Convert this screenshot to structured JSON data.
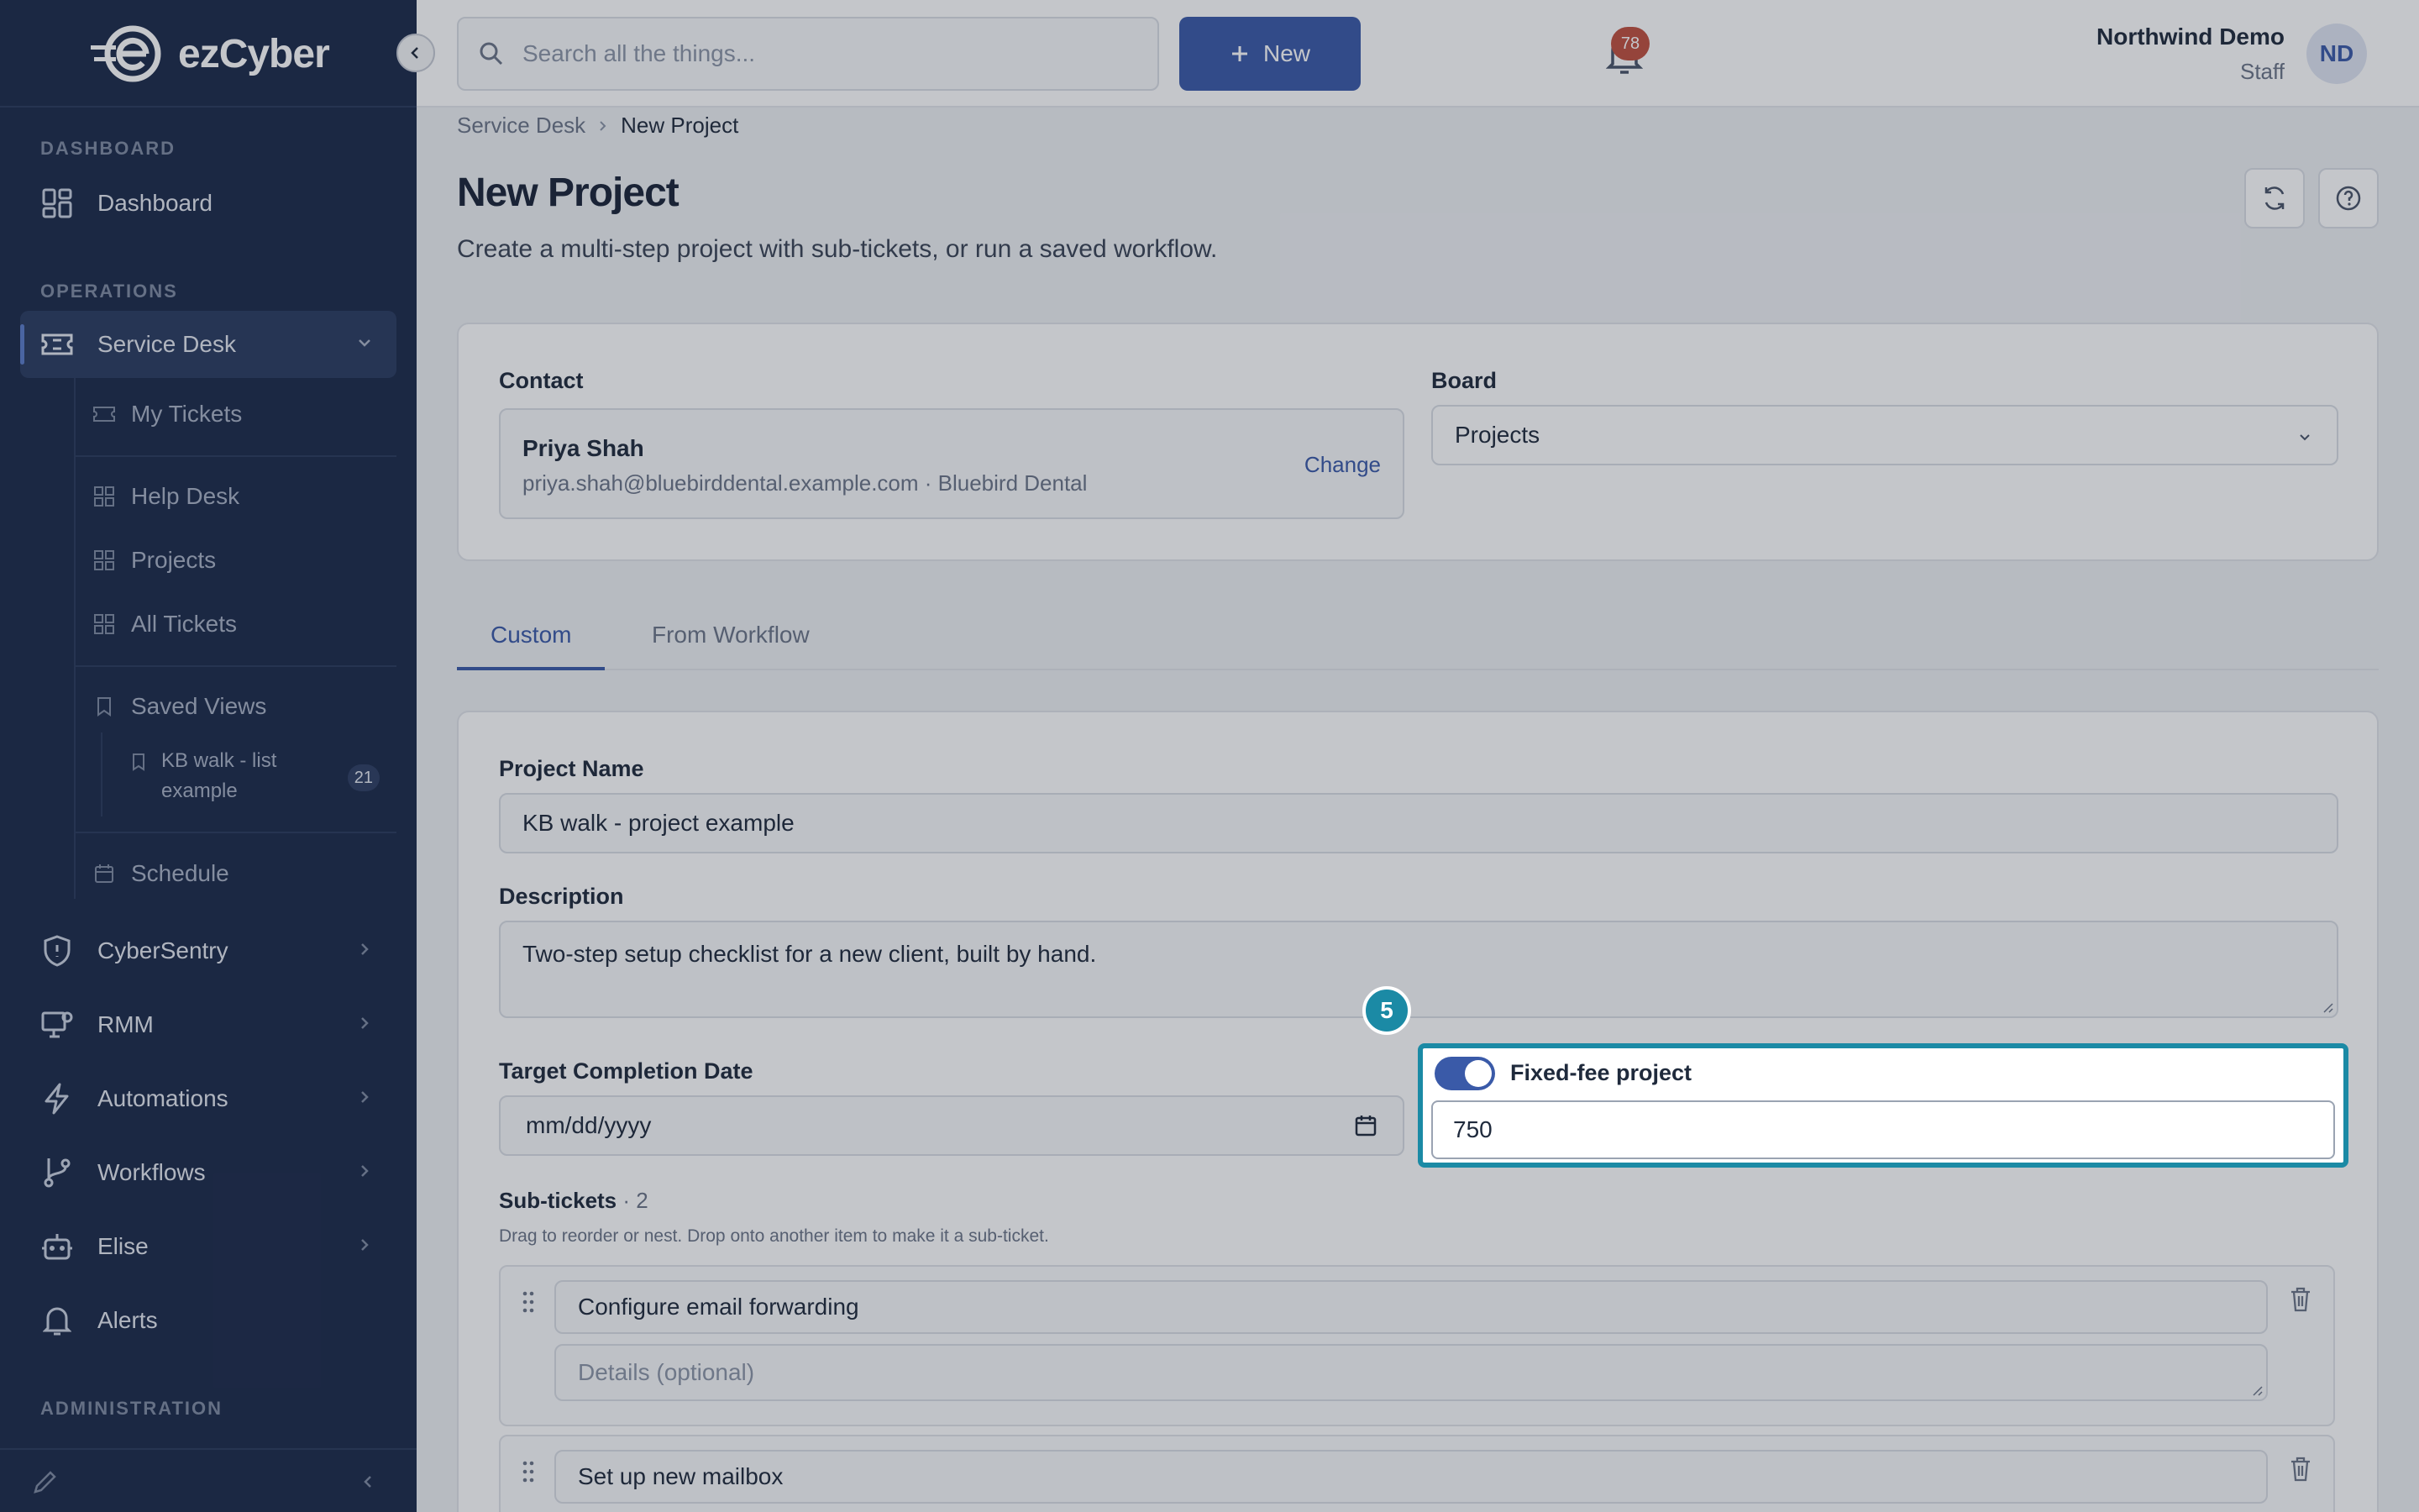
{
  "app": {
    "brand": "ezCyber"
  },
  "sidebar": {
    "sections": {
      "dashboard": "DASHBOARD",
      "operations": "OPERATIONS",
      "administration": "ADMINISTRATION"
    },
    "dashboard": "Dashboard",
    "service_desk": "Service Desk",
    "sub_items": {
      "my_tickets": "My Tickets",
      "help_desk": "Help Desk",
      "projects": "Projects",
      "all_tickets": "All Tickets",
      "saved_views": "Saved Views",
      "saved_view_item": "KB walk - list example",
      "saved_view_count": "21",
      "schedule": "Schedule"
    },
    "items": {
      "cybersentry": "CyberSentry",
      "rmm": "RMM",
      "automations": "Automations",
      "workflows": "Workflows",
      "elise": "Elise",
      "alerts": "Alerts"
    }
  },
  "header": {
    "search_placeholder": "Search all the things...",
    "new_label": "New",
    "notifications_count": "78",
    "user_name": "Northwind Demo",
    "user_role": "Staff",
    "avatar_initials": "ND"
  },
  "breadcrumb": {
    "parent": "Service Desk",
    "current": "New Project"
  },
  "page": {
    "title": "New Project",
    "subtitle": "Create a multi-step project with sub-tickets, or run a saved workflow."
  },
  "contact": {
    "label": "Contact",
    "name": "Priya Shah",
    "meta": "priya.shah@bluebirddental.example.com · Bluebird Dental",
    "change_label": "Change"
  },
  "board": {
    "label": "Board",
    "value": "Projects"
  },
  "tabs": {
    "custom": "Custom",
    "from_workflow": "From Workflow"
  },
  "form": {
    "project_name_label": "Project Name",
    "project_name_value": "KB walk - project example",
    "description_label": "Description",
    "description_value": "Two-step setup checklist for a new client, built by hand.",
    "target_date_label": "Target Completion Date",
    "target_date_placeholder": "mm/dd/yyyy",
    "fixed_fee_label": "Fixed-fee project",
    "fixed_fee_enabled": true,
    "fixed_fee_value": "750",
    "step_badge": "5"
  },
  "subtickets": {
    "label": "Sub-tickets",
    "count": "· 2",
    "hint": "Drag to reorder or nest. Drop onto another item to make it a sub-ticket.",
    "items": [
      {
        "title": "Configure email forwarding",
        "details_placeholder": "Details (optional)"
      },
      {
        "title": "Set up new mailbox"
      }
    ]
  },
  "colors": {
    "sidebar_bg": "#1c2a4a",
    "accent": "#3a5aa8",
    "spotlight": "#1b8aa5",
    "badge": "#c0503f"
  }
}
